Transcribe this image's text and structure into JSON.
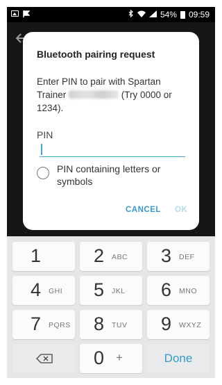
{
  "status_bar": {
    "battery": "54%",
    "time": "09:59"
  },
  "dialog": {
    "title": "Bluetooth pairing request",
    "message_before": "Enter PIN to pair with Spartan Trainer ",
    "message_after": " (Try 0000 or 1234).",
    "pin_label": "PIN",
    "pin_value": "",
    "checkbox_label": "PIN containing letters or symbols",
    "checkbox_checked": false,
    "cancel_label": "CANCEL",
    "ok_label": "OK"
  },
  "keypad": {
    "keys": [
      {
        "num": "1",
        "letters": ""
      },
      {
        "num": "2",
        "letters": "ABC"
      },
      {
        "num": "3",
        "letters": "DEF"
      },
      {
        "num": "4",
        "letters": "GHI"
      },
      {
        "num": "5",
        "letters": "JKL"
      },
      {
        "num": "6",
        "letters": "MNO"
      },
      {
        "num": "7",
        "letters": "PQRS"
      },
      {
        "num": "8",
        "letters": "TUV"
      },
      {
        "num": "9",
        "letters": "WXYZ"
      }
    ],
    "zero": "0",
    "plus": "+",
    "done_label": "Done"
  },
  "colors": {
    "accent": "#3a98c7",
    "ok_disabled": "#b9dbe9",
    "keypad_bg": "#e5e6e8"
  },
  "icons": {
    "status_left": [
      "gallery-icon",
      "flag-icon"
    ],
    "status_right": [
      "bluetooth-icon",
      "wifi-icon",
      "signal-icon",
      "battery-icon"
    ],
    "backspace": "backspace-icon",
    "back": "back-arrow-icon"
  }
}
